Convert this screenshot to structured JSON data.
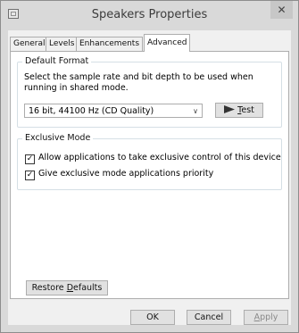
{
  "window": {
    "title": "Speakers Properties",
    "close_label": "✕",
    "app_icon": "window-icon"
  },
  "tabs": [
    {
      "label": "General",
      "active": false
    },
    {
      "label": "Levels",
      "active": false
    },
    {
      "label": "Enhancements",
      "active": false
    },
    {
      "label": "Advanced",
      "active": true
    }
  ],
  "default_format": {
    "group_label": "Default Format",
    "description": "Select the sample rate and bit depth to be used when running in shared mode.",
    "selected_format": "16 bit, 44100 Hz (CD Quality)",
    "dropdown_icon": "chevron-down-icon",
    "test_button": {
      "icon": "play-icon",
      "mnemonic": "T",
      "rest": "est"
    }
  },
  "exclusive_mode": {
    "group_label": "Exclusive Mode",
    "options": [
      {
        "label": "Allow applications to take exclusive control of this device",
        "checked": true
      },
      {
        "label": "Give exclusive mode applications priority",
        "checked": true
      }
    ]
  },
  "restore_defaults": {
    "before": "Restore ",
    "mnemonic": "D",
    "after": "efaults"
  },
  "footer": {
    "ok_label": "OK",
    "cancel_label": "Cancel",
    "apply_mnemonic": "A",
    "apply_rest": "pply"
  }
}
